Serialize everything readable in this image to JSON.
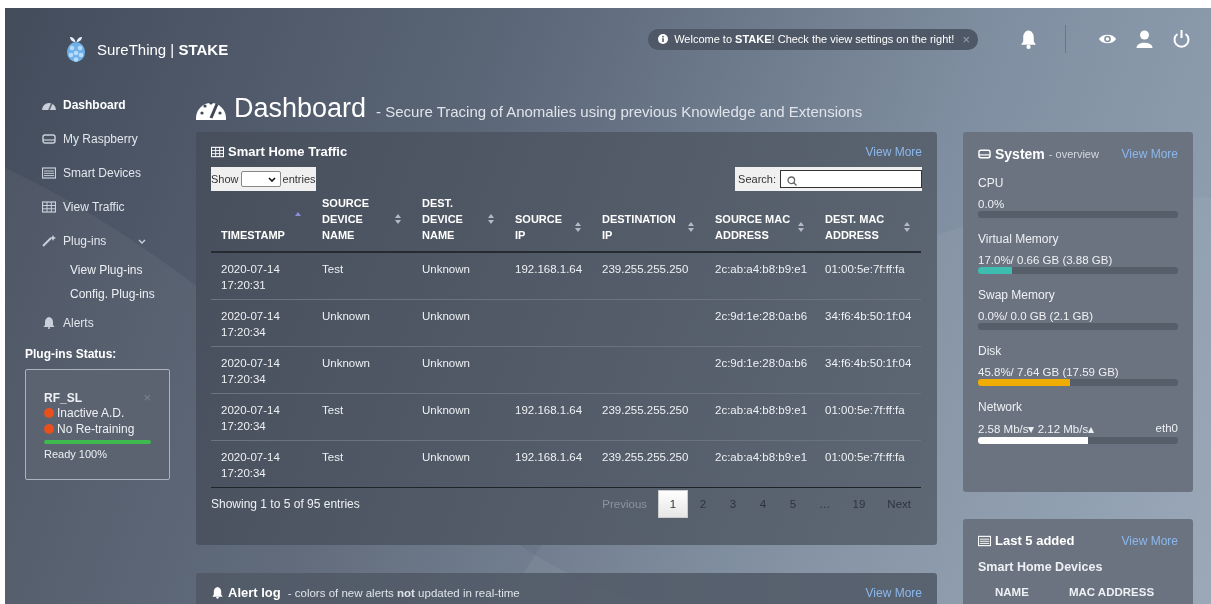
{
  "header": {
    "brand": "SureThing | **STAKE**",
    "notice": "Welcome to **STAKE**! Check the view settings on the right!",
    "notice_close": "×"
  },
  "sidebar": {
    "items": [
      {
        "label": "Dashboard",
        "selected": true
      },
      {
        "label": "My Raspberry",
        "selected": false
      },
      {
        "label": "Smart Devices",
        "selected": false
      },
      {
        "label": "View Traffic",
        "selected": false
      },
      {
        "label": "Plug-ins",
        "selected": false,
        "expanded": true,
        "children": [
          {
            "label": "View Plug-ins",
            "selected": false
          },
          {
            "label": "Config. Plug-ins",
            "selected": false
          }
        ]
      },
      {
        "label": "Alerts",
        "selected": false
      }
    ],
    "status_title": "Plug-ins Status:",
    "plugins": [
      {
        "name": "RF_SL",
        "close": "×",
        "statuses": [
          {
            "label": "Inactive A.D.",
            "color": "#e8501e"
          },
          {
            "label": "No Re-training",
            "color": "#e8501e"
          }
        ],
        "level": 1.0,
        "reading": "Ready 100%"
      }
    ]
  },
  "page": {
    "title": "Dashboard",
    "subtitle": "- Secure Tracing of Anomalies using previous Knowledge and Extensions"
  },
  "traffic": {
    "title": "Smart Home Traffic",
    "view_more": "View More",
    "show_label": "Show",
    "entries_label": "entries",
    "search_label": "Search:",
    "columns": [
      {
        "label": "TIMESTAMP",
        "sorted": true
      },
      {
        "label": "SOURCE DEVICE NAME",
        "sorted": false
      },
      {
        "label": "DEST. DEVICE NAME",
        "sorted": false
      },
      {
        "label": "SOURCE IP",
        "sorted": false
      },
      {
        "label": "DESTINATION IP",
        "sorted": false
      },
      {
        "label": "SOURCE MAC ADDRESS",
        "sorted": false
      },
      {
        "label": "DEST. MAC ADDRESS",
        "sorted": false
      }
    ],
    "rows": [
      [
        "2020-07-14 17:20:31",
        "Test",
        "Unknown",
        "192.168.1.64",
        "239.255.255.250",
        "2c:ab:a4:b8:b9:e1",
        "01:00:5e:7f:ff:fa"
      ],
      [
        "2020-07-14 17:20:34",
        "Unknown",
        "Unknown",
        "",
        "",
        "2c:9d:1e:28:0a:b6",
        "34:f6:4b:50:1f:04"
      ],
      [
        "2020-07-14 17:20:34",
        "Unknown",
        "Unknown",
        "",
        "",
        "2c:9d:1e:28:0a:b6",
        "34:f6:4b:50:1f:04"
      ],
      [
        "2020-07-14 17:20:34",
        "Test",
        "Unknown",
        "192.168.1.64",
        "239.255.255.250",
        "2c:ab:a4:b8:b9:e1",
        "01:00:5e:7f:ff:fa"
      ],
      [
        "2020-07-14 17:20:34",
        "Test",
        "Unknown",
        "192.168.1.64",
        "239.255.255.250",
        "2c:ab:a4:b8:b9:e1",
        "01:00:5e:7f:ff:fa"
      ]
    ],
    "info": "Showing 1 to 5 of 95 entries",
    "pagination": [
      {
        "label": "Previous",
        "selected": false,
        "disabled": true
      },
      {
        "label": "1",
        "selected": true,
        "disabled": false
      },
      {
        "label": "2",
        "selected": false,
        "disabled": false
      },
      {
        "label": "3",
        "selected": false,
        "disabled": false
      },
      {
        "label": "4",
        "selected": false,
        "disabled": false
      },
      {
        "label": "5",
        "selected": false,
        "disabled": false
      },
      {
        "label": "…",
        "selected": false,
        "disabled": false
      },
      {
        "label": "19",
        "selected": false,
        "disabled": false
      },
      {
        "label": "Next",
        "selected": false,
        "disabled": false
      }
    ]
  },
  "alert_log": {
    "title": "Alert log",
    "note": "- colors of new alerts **not** updated in real-time",
    "view_more": "View More"
  },
  "system": {
    "title": "System",
    "subtitle": "- overview",
    "view_more": "View More",
    "meters": [
      {
        "name": "CPU",
        "reading": "0.0%"
      },
      {
        "name": "Virtual Memory",
        "reading": "17.0%/ 0.66 GB (3.88 GB)",
        "level": 0.17,
        "color": "#3dbdb0"
      },
      {
        "name": "Swap Memory",
        "reading": "0.0%/ 0.0 GB (2.1 GB)"
      },
      {
        "name": "Disk",
        "reading": "45.8%/ 7.64 GB (17.59 GB)",
        "level": 0.458,
        "color": "#f0ac00"
      },
      {
        "name": "Network",
        "reading": "2.58 Mb/s▾ 2.12 Mb/s▴",
        "interface": "eth0",
        "level": 0.55,
        "color": "#ffffff"
      }
    ]
  },
  "last_added": {
    "title": "Last 5 added",
    "view_more": "View More",
    "subtitle": "Smart Home Devices",
    "columns": [
      "NAME",
      "MAC ADDRESS"
    ]
  }
}
